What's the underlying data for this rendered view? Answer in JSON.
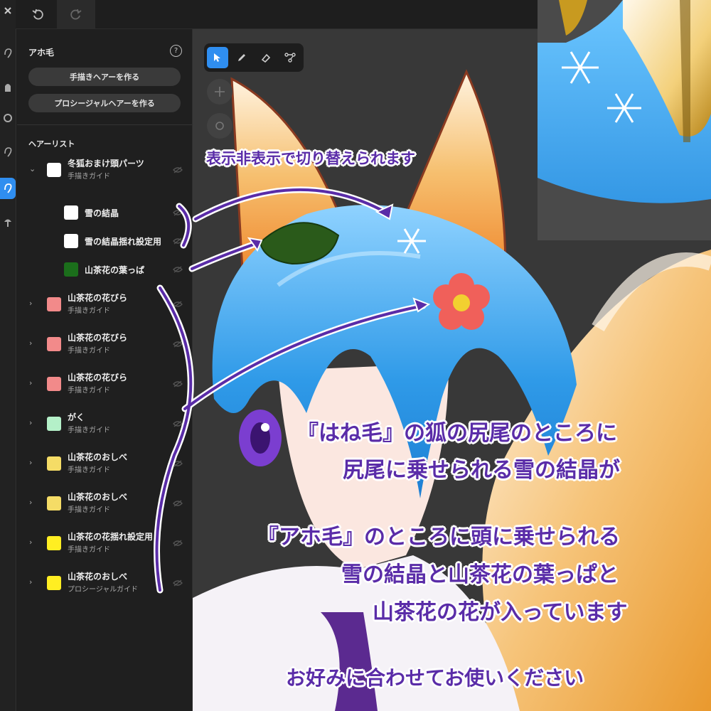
{
  "panel": {
    "title": "アホ毛",
    "help_icon": "help-circle-icon",
    "buttons": {
      "handdrawn": "手描きヘアーを作る",
      "procedural": "プロシージャルヘアーを作る"
    },
    "list_title": "ヘアーリスト"
  },
  "hair_list": [
    {
      "name": "冬狐おまけ頭パーツ",
      "sub": "手描きガイド",
      "color": "#ffffff",
      "expanded": true
    },
    {
      "name": "雪の結晶",
      "sub": "",
      "color": "#ffffff",
      "child": true
    },
    {
      "name": "雪の結晶揺れ設定用",
      "sub": "",
      "color": "#ffffff",
      "child": true
    },
    {
      "name": "山茶花の葉っぱ",
      "sub": "",
      "color": "#1b6e1b",
      "child": true
    },
    {
      "name": "山茶花の花びら",
      "sub": "手描きガイド",
      "color": "#f28a8a"
    },
    {
      "name": "山茶花の花びら",
      "sub": "手描きガイド",
      "color": "#f28a8a"
    },
    {
      "name": "山茶花の花びら",
      "sub": "手描きガイド",
      "color": "#f28a8a"
    },
    {
      "name": "がく",
      "sub": "手描きガイド",
      "color": "#b4f0c8"
    },
    {
      "name": "山茶花のおしべ",
      "sub": "手描きガイド",
      "color": "#f5dc66"
    },
    {
      "name": "山茶花のおしべ",
      "sub": "手描きガイド",
      "color": "#f5dc66"
    },
    {
      "name": "山茶花の花揺れ設定用",
      "sub": "手描きガイド",
      "color": "#ffee22"
    },
    {
      "name": "山茶花のおしべ",
      "sub": "プロシージャルガイド",
      "color": "#ffee22"
    }
  ],
  "annotations": {
    "toggle_note": "表示非表示で切り替えられます",
    "line1": "『はね毛』の狐の尻尾のところに",
    "line2": "尻尾に乗せられる雪の結晶が",
    "line3": "『アホ毛』のところに頭に乗せられる",
    "line4": "雪の結晶と山茶花の葉っぱと",
    "line5": "山茶花の花が入っています",
    "line6": "お好みに合わせてお使いください"
  },
  "colors": {
    "accent": "#2f8ef0",
    "annotation": "#5a2ca8",
    "hair": "#39a8ec",
    "ear": "#f0a040"
  }
}
